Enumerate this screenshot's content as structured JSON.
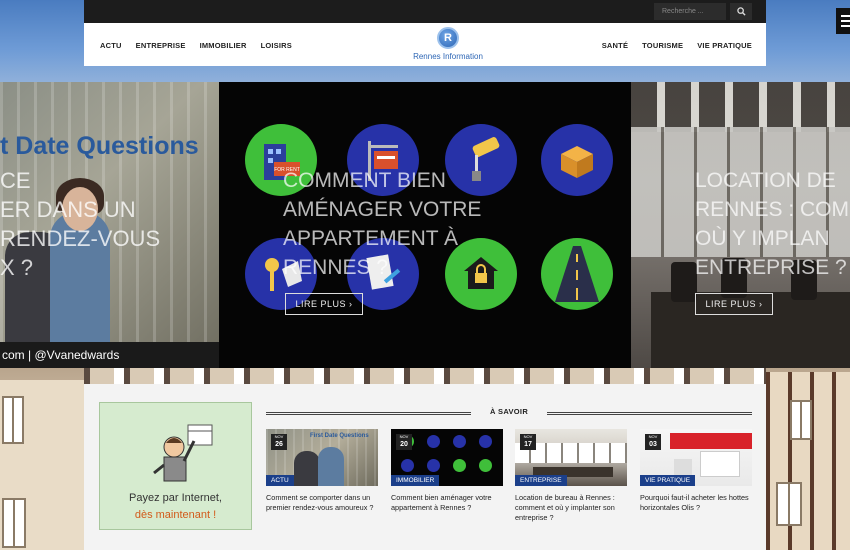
{
  "colors": {
    "accent": "#1b3f8a",
    "ad_highlight": "#d25a1a",
    "logo_blue": "#2d66b5"
  },
  "topbar": {
    "search_placeholder": "Recherche ...",
    "search_icon": "search-icon"
  },
  "nav": {
    "left": [
      "ACTU",
      "ENTREPRISE",
      "IMMOBILIER",
      "LOISIRS"
    ],
    "right": [
      "SANTÉ",
      "TOURISME",
      "VIE PRATIQUE"
    ],
    "logo_letter": "R",
    "logo_text": "Rennes Information"
  },
  "slider": {
    "left": {
      "headline": "t Date Questions",
      "overlay_lines": [
        "CE",
        "ER DANS UN",
        "RENDEZ-VOUS",
        "X ?"
      ],
      "credit": "com | @Vvanedwards"
    },
    "center": {
      "title": "COMMENT BIEN AMÉNAGER VOTRE APPARTEMENT À RENNES ?",
      "button": "LIRE PLUS",
      "icon_sign_text": "FOR RENT"
    },
    "right": {
      "title_lines": [
        "LOCATION DE",
        "RENNES : COM",
        "OÙ Y IMPLAN",
        "ENTREPRISE ?"
      ],
      "button": "LIRE PLUS"
    }
  },
  "ad": {
    "line1": "Payez par Internet,",
    "line2": "dès maintenant !"
  },
  "section": {
    "title": "À SAVOIR"
  },
  "cards": [
    {
      "month": "NOV",
      "day": "26",
      "category": "ACTU",
      "thumb_text": "First Date Questions",
      "caption": "Comment se comporter dans un premier rendez-vous amoureux ?"
    },
    {
      "month": "NOV",
      "day": "20",
      "category": "IMMOBILIER",
      "caption": "Comment bien aménager votre appartement à Rennes ?"
    },
    {
      "month": "NOV",
      "day": "17",
      "category": "ENTREPRISE",
      "caption": "Location de bureau à Rennes : comment et où y implanter son entreprise ?"
    },
    {
      "month": "NOV",
      "day": "03",
      "category": "VIE PRATIQUE",
      "caption": "Pourquoi faut-il acheter les hottes horizontales Olis ?"
    }
  ]
}
